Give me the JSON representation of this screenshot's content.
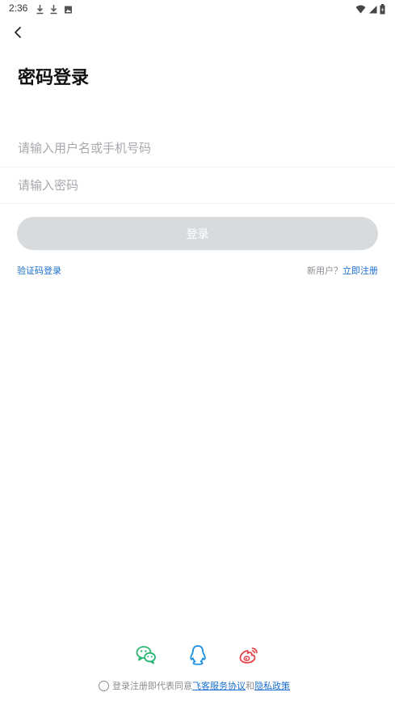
{
  "status_bar": {
    "time": "2:36",
    "icons": [
      "download-icon",
      "download-icon",
      "image-icon",
      "wifi-icon",
      "signal-icon",
      "battery-icon"
    ]
  },
  "header": {
    "back_icon": "chevron-left-icon",
    "title": "密码登录"
  },
  "form": {
    "username_placeholder": "请输入用户名或手机号码",
    "username_value": "",
    "password_placeholder": "请输入密码",
    "password_value": "",
    "login_label": "登录",
    "login_button_color": "#d8dbde"
  },
  "links": {
    "sms_login": "验证码登录",
    "new_user_prompt": "新用户？",
    "register": "立即注册"
  },
  "social": {
    "items": [
      "wechat-icon",
      "qq-icon",
      "weibo-icon"
    ],
    "colors": {
      "wechat": "#2bb673",
      "qq": "#1a8fe3",
      "weibo": "#e8434a"
    }
  },
  "agreement": {
    "prefix": "登录注册即代表同意",
    "service_link": "飞客服务协议",
    "and": "和",
    "privacy_link": "隐私政策"
  },
  "accent_color": "#1a6fd1"
}
